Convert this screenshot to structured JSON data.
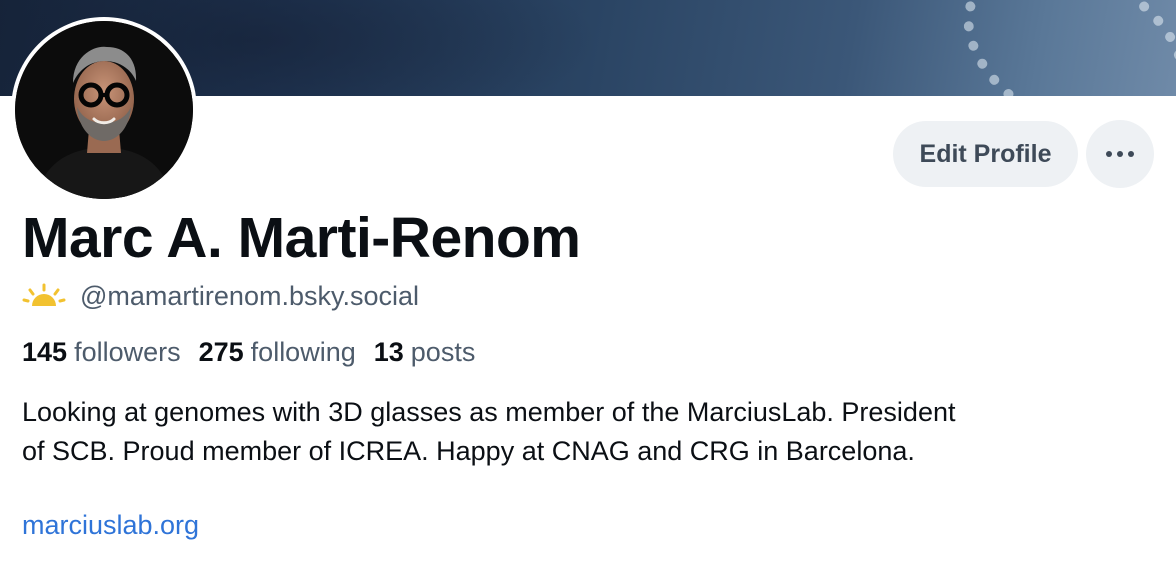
{
  "profile": {
    "display_name": "Marc A. Marti-Renom",
    "handle": "@mamartirenom.bsky.social",
    "handle_icon": "sun-icon",
    "bio_line1": "Looking at genomes with 3D glasses as member of the MarciusLab. President",
    "bio_line2": "of SCB. Proud member of ICREA. Happy at CNAG and CRG in Barcelona.",
    "website": "marciuslab.org"
  },
  "stats": {
    "followers_count": "145",
    "followers_label": "followers",
    "following_count": "275",
    "following_label": "following",
    "posts_count": "13",
    "posts_label": "posts"
  },
  "actions": {
    "edit_profile_label": "Edit Profile",
    "more_icon": "more-horizontal-icon"
  },
  "colors": {
    "accent_link": "#2f74d8",
    "button_bg": "#eef1f4",
    "secondary_text": "#4d5b6b",
    "sun_icon": "#f2c230"
  }
}
